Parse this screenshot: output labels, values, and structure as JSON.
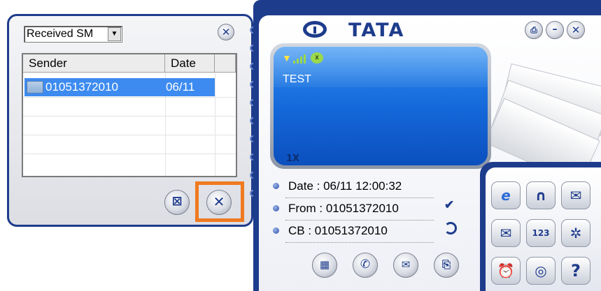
{
  "sms_window": {
    "folder_selected": "Received SM",
    "close_glyph": "✕",
    "columns": [
      "Sender",
      "Date"
    ],
    "messages": [
      {
        "sender": "01051372010",
        "date": "06/11",
        "icon": "envelope-icon",
        "selected": true
      }
    ],
    "delete_glyph": "⊠",
    "close_button_glyph": "✕",
    "highlighted_button": "sms-close-button"
  },
  "main_window": {
    "brand": "TATA",
    "title_buttons": {
      "print_glyph": "⎙",
      "minimize_glyph": "–",
      "close_glyph": "✕"
    },
    "lcd": {
      "message": "TEST",
      "network_mode": "1X",
      "icons": [
        "antenna-icon",
        "signal-strength-icon",
        "status-icon"
      ],
      "signal_level_bars": 4,
      "antenna_glyph": "▼",
      "status_glyph": "x"
    },
    "details": {
      "date": "Date : 06/11 12:00:32",
      "from": "From : 01051372010",
      "cb": "CB : 01051372010"
    },
    "read_glyph": "✔",
    "actions": [
      {
        "name": "save-to-phonebook-button",
        "glyph": "▦"
      },
      {
        "name": "call-button",
        "glyph": "✆"
      },
      {
        "name": "reply-button",
        "glyph": "✉"
      },
      {
        "name": "forward-button",
        "glyph": "⎘"
      }
    ]
  },
  "function_panel": {
    "buttons": [
      {
        "name": "browser-button",
        "glyph": "e"
      },
      {
        "name": "headset-button",
        "glyph": "∩"
      },
      {
        "name": "send-message-button",
        "glyph": "✉"
      },
      {
        "name": "inbox-button",
        "glyph": "✉"
      },
      {
        "name": "calendar-button",
        "glyph": "123"
      },
      {
        "name": "settings-button",
        "glyph": "✲"
      },
      {
        "name": "alarm-button",
        "glyph": "⏰"
      },
      {
        "name": "tata-home-button",
        "glyph": "◎"
      },
      {
        "name": "help-button",
        "glyph": "?"
      }
    ]
  },
  "colors": {
    "frame_blue": "#1e3c8c",
    "lcd_blue": "#1466d8",
    "selection_blue": "#3d8bf0",
    "highlight_orange": "#f07a20"
  }
}
